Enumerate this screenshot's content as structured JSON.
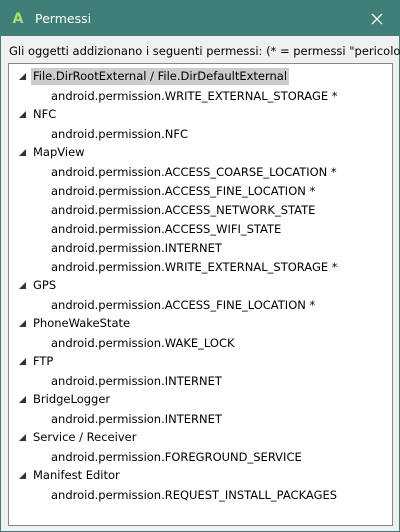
{
  "window": {
    "title": "Permessi",
    "app_icon_letter": "A",
    "close_icon": "close-icon"
  },
  "description": "Gli oggetti addizionano i seguenti permessi: (* = permessi \"pericolosi\")",
  "tree": [
    {
      "label": "File.DirRootExternal / File.DirDefaultExternal",
      "selected": true,
      "children": [
        "android.permission.WRITE_EXTERNAL_STORAGE *"
      ]
    },
    {
      "label": "NFC",
      "children": [
        "android.permission.NFC"
      ]
    },
    {
      "label": "MapView",
      "children": [
        "android.permission.ACCESS_COARSE_LOCATION *",
        "android.permission.ACCESS_FINE_LOCATION *",
        "android.permission.ACCESS_NETWORK_STATE",
        "android.permission.ACCESS_WIFI_STATE",
        "android.permission.INTERNET",
        "android.permission.WRITE_EXTERNAL_STORAGE *"
      ]
    },
    {
      "label": "GPS",
      "children": [
        "android.permission.ACCESS_FINE_LOCATION *"
      ]
    },
    {
      "label": "PhoneWakeState",
      "children": [
        "android.permission.WAKE_LOCK"
      ]
    },
    {
      "label": "FTP",
      "children": [
        "android.permission.INTERNET"
      ]
    },
    {
      "label": "BridgeLogger",
      "children": [
        "android.permission.INTERNET"
      ]
    },
    {
      "label": "Service / Receiver",
      "children": [
        "android.permission.FOREGROUND_SERVICE"
      ]
    },
    {
      "label": "Manifest Editor",
      "children": [
        "android.permission.REQUEST_INSTALL_PACKAGES"
      ]
    }
  ],
  "colors": {
    "titlebar": "#3f7f78",
    "selection": "#cccccc"
  }
}
